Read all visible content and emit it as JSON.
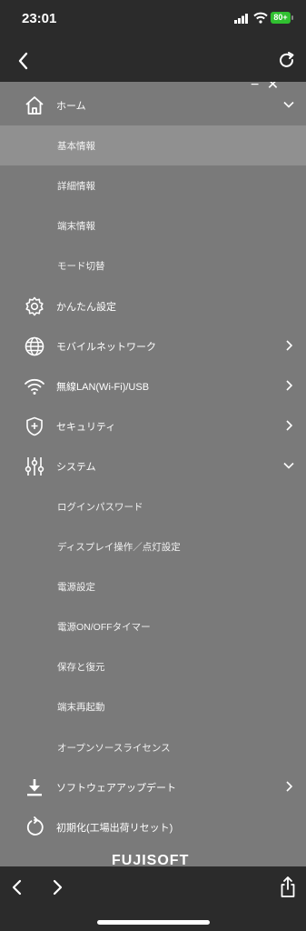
{
  "status": {
    "time": "23:01",
    "battery": "80+"
  },
  "close_fragment": "− ✕",
  "menu": {
    "home": {
      "label": "ホーム",
      "icon": "home-icon",
      "items": [
        "基本情報",
        "詳細情報",
        "端末情報",
        "モード切替"
      ],
      "selected": "基本情報"
    },
    "easy": {
      "label": "かんたん設定",
      "icon": "gear-icon"
    },
    "mobile": {
      "label": "モバイルネットワーク",
      "icon": "globe-icon"
    },
    "wlan": {
      "label": "無線LAN(Wi-Fi)/USB",
      "icon": "wifi-icon"
    },
    "security": {
      "label": "セキュリティ",
      "icon": "shield-icon"
    },
    "system": {
      "label": "システム",
      "icon": "sliders-icon",
      "items": [
        "ログインパスワード",
        "ディスプレイ操作／点灯設定",
        "電源設定",
        "電源ON/OFFタイマー",
        "保存と復元",
        "端末再起動",
        "オープンソースライセンス"
      ]
    },
    "update": {
      "label": "ソフトウェアアップデート",
      "icon": "download-icon"
    },
    "reset": {
      "label": "初期化(工場出荷リセット)",
      "icon": "reset-icon"
    }
  },
  "brand_fragment": "FUJISOFT",
  "colors": {
    "bar": "#2b2b2b",
    "menu_bg": "#7a7a7a",
    "selected_bg": "#909090",
    "battery": "#30c030"
  }
}
